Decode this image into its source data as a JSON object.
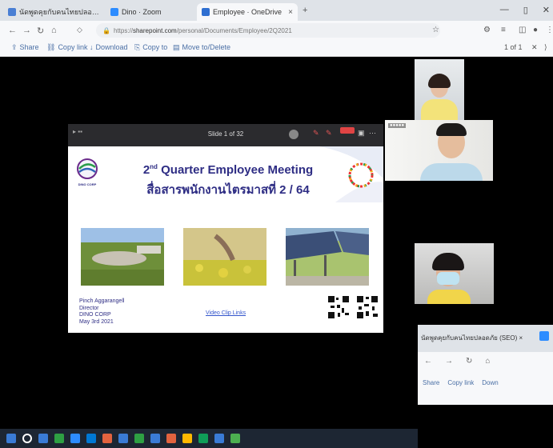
{
  "browser": {
    "tabs": [
      {
        "label": "นัดพูดคุยกับคนไทยปลอดภัย (SEO) ×",
        "favicon_color": "#4a7fd4",
        "active": false
      },
      {
        "label": "Dino · Zoom",
        "favicon_color": "#2d8cff",
        "active": false
      },
      {
        "label": "Employee · OneDrive",
        "favicon_color": "#2f6fd1",
        "active": true
      }
    ],
    "window_controls": {
      "minimize": "—",
      "maximize": "▯",
      "close": "✕"
    },
    "address": {
      "prefix": "https://",
      "domain": "sharepoint.com",
      "rest": "/personal/Documents/Employee/2Q2021"
    },
    "command_bar": {
      "items": [
        "Share",
        "Copy link",
        "Download",
        "Copy to",
        "Move to/Delete"
      ],
      "page_indicator": "1 of 1"
    }
  },
  "share_window": {
    "slide_counter": "Slide 1 of 32",
    "slide": {
      "title_line1_a": "2",
      "title_line1_sup": "nd",
      "title_line1_b": " Quarter Employee Meeting",
      "title_line2": "สื่อสารพนักงานไตรมาสที่ 2 / 64",
      "logo_text": "DINO CORP",
      "presenter": [
        "Pinch Aggarangell",
        "Director",
        "DINO CORP",
        "May 3rd 2021"
      ],
      "link_text": "Video Clip Links"
    }
  },
  "secondary_window": {
    "tab_text": "นัดพูดคุยกับคนไทยปลอดภัย (SEO) ×",
    "cmds": [
      "Share",
      "Copy link",
      "Down"
    ]
  },
  "taskbar_colors": [
    "#3a7bd5",
    "#ffffff",
    "#3a7bd5",
    "#2ea043",
    "#2d8cff",
    "#0078d4",
    "#e2633f",
    "#3a7bd5",
    "#2ea043",
    "#3a7bd5",
    "#e2633f",
    "#ffb900",
    "#0f9d58",
    "#3a7bd5",
    "#4caf50"
  ]
}
